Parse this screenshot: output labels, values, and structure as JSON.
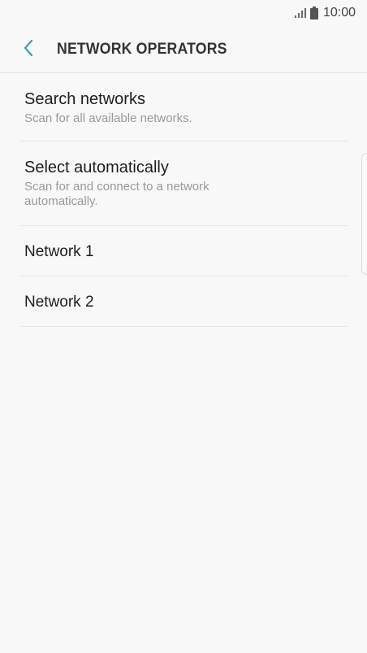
{
  "status_bar": {
    "signal_icon": "signal-icon",
    "battery_icon": "battery-icon",
    "time": "10:00"
  },
  "header": {
    "back_icon": "chevron-left-icon",
    "title": "NETWORK OPERATORS",
    "accent_color": "#3aa0b4"
  },
  "list": {
    "items": [
      {
        "title": "Search networks",
        "subtitle": "Scan for all available networks."
      },
      {
        "title": "Select automatically",
        "subtitle": "Scan for and connect to a network automatically."
      },
      {
        "title": "Network 1"
      },
      {
        "title": "Network 2"
      }
    ]
  }
}
